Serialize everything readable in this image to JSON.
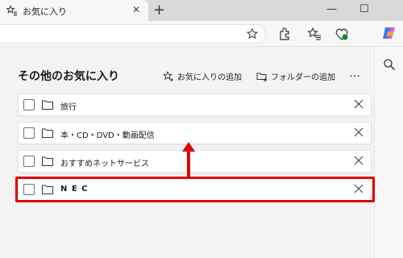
{
  "tab": {
    "title": "お気に入り",
    "close": "✕",
    "new_tab": "+"
  },
  "window": {
    "minimize": "—",
    "maximize": "☐"
  },
  "page": {
    "heading": "その他のお気に入り",
    "add_favorite": "お気に入りの追加",
    "add_folder": "フォルダーの追加",
    "more": "…"
  },
  "items": [
    {
      "label": "旅行"
    },
    {
      "label": "本・CD・DVD・動画配信"
    },
    {
      "label": "おすすめネットサービス"
    },
    {
      "label": "N E C"
    }
  ],
  "colors": {
    "highlight": "#e00000"
  }
}
